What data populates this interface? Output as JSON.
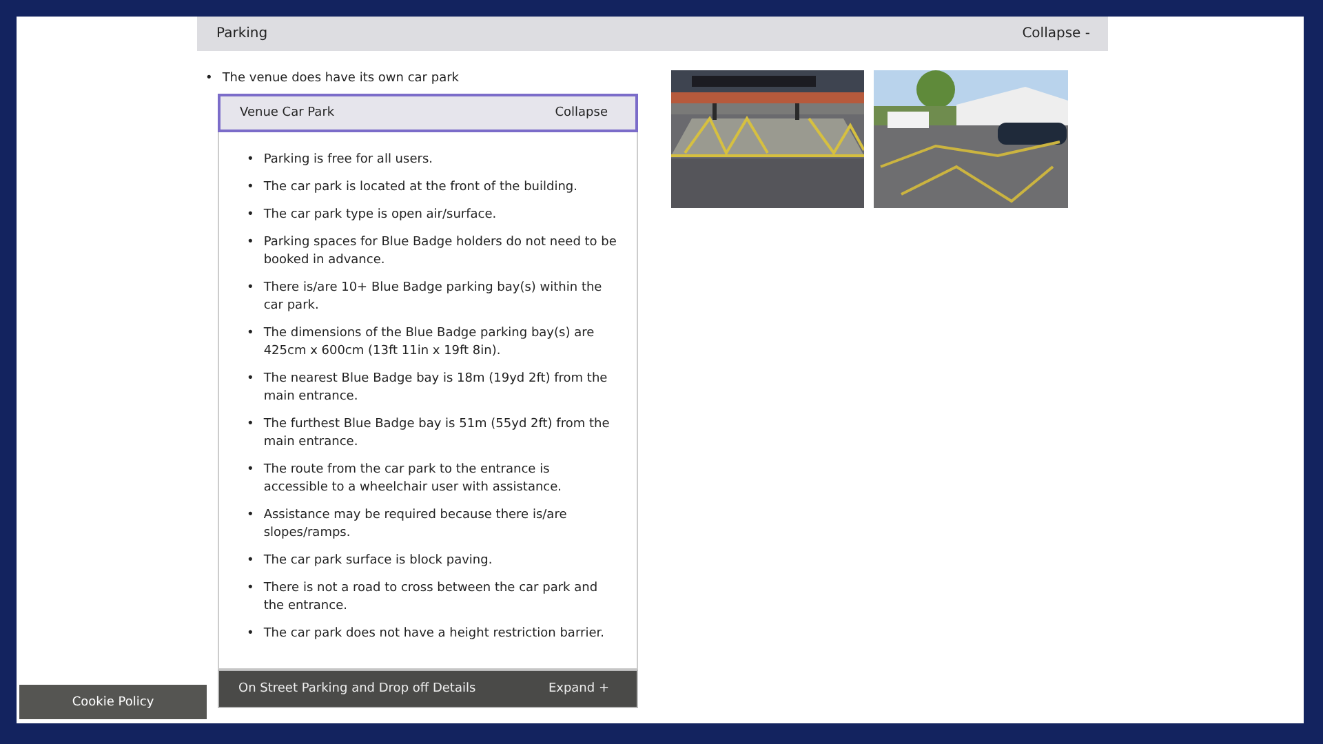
{
  "header": {
    "title": "Parking",
    "toggle": "Collapse -",
    "expanded": true
  },
  "intro": [
    "The venue does have its own car park"
  ],
  "sub_sections": [
    {
      "title": "Venue Car Park",
      "toggle": "Collapse",
      "expanded": true,
      "focused": true,
      "items": [
        "Parking is free for all users.",
        "The car park is located at the front of the building.",
        "The car park type is open air/surface.",
        "Parking spaces for Blue Badge holders do not need to be booked in advance.",
        "There is/are 10+ Blue Badge parking bay(s) within the car park.",
        "The dimensions of the Blue Badge parking bay(s) are 425cm x 600cm (13ft 11in x 19ft 8in).",
        "The nearest Blue Badge bay is 18m (19yd 2ft) from the main entrance.",
        "The furthest Blue Badge bay is 51m (55yd 2ft) from the main entrance.",
        "The route from the car park to the entrance is accessible to a wheelchair user with assistance.",
        "Assistance may be required because there is/are slopes/ramps.",
        "The car park surface is block paving.",
        "There is not a road to cross between the car park and the entrance.",
        "The car park does not have a height restriction barrier."
      ]
    },
    {
      "title": "On Street Parking and Drop off Details",
      "toggle": "Expand +",
      "expanded": false,
      "focused": false
    }
  ],
  "bullet": "•",
  "cookie_button": "Cookie Policy"
}
